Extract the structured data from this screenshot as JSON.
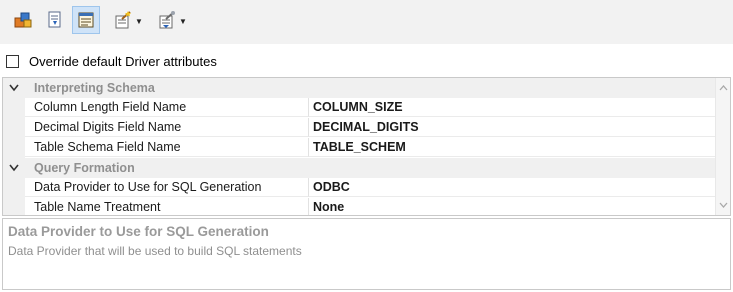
{
  "toolbar": {
    "buttons": [
      {
        "icon": "cubes-icon"
      },
      {
        "icon": "download-doc-icon"
      },
      {
        "icon": "properties-icon",
        "active": true
      },
      {
        "icon": "wand-edit-icon",
        "dropdown": true
      },
      {
        "icon": "wand-import-icon",
        "dropdown": true
      }
    ]
  },
  "override": {
    "label": "Override default Driver attributes",
    "checked": false
  },
  "grid": {
    "categories": [
      {
        "title": "Interpreting Schema",
        "expanded": true,
        "properties": [
          {
            "name": "Column Length Field Name",
            "value": "COLUMN_SIZE"
          },
          {
            "name": "Decimal Digits Field Name",
            "value": "DECIMAL_DIGITS"
          },
          {
            "name": "Table Schema Field Name",
            "value": "TABLE_SCHEM"
          }
        ]
      },
      {
        "title": "Query Formation",
        "expanded": true,
        "properties": [
          {
            "name": "Data Provider to Use for SQL Generation",
            "value": "ODBC"
          },
          {
            "name": "Table Name Treatment",
            "value": "None"
          }
        ]
      }
    ]
  },
  "description": {
    "title": "Data Provider to Use for SQL Generation",
    "text": "Data Provider that will be used to build SQL statements"
  }
}
